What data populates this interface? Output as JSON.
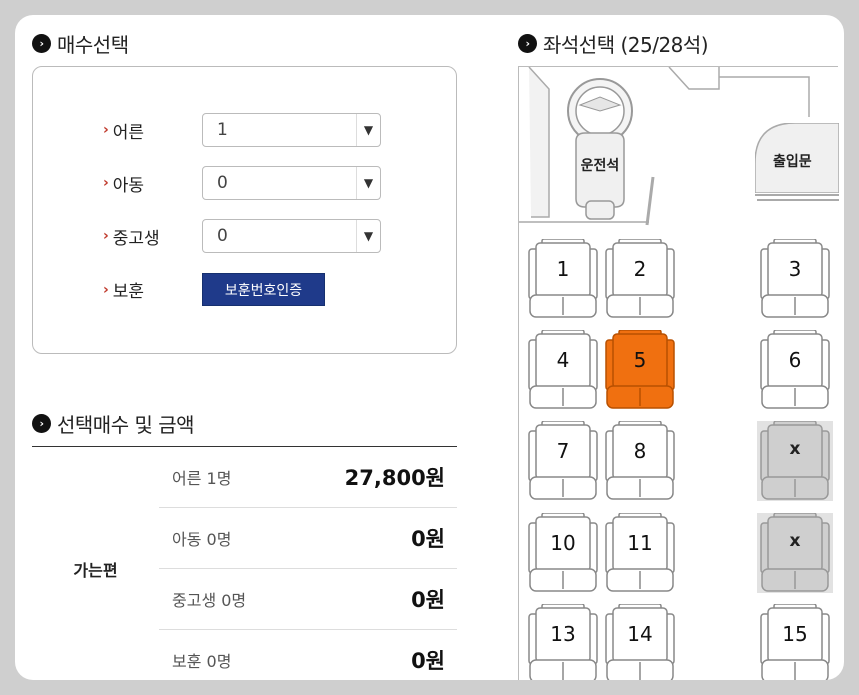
{
  "ticket": {
    "title": "매수선택",
    "rows": [
      {
        "label": "어른",
        "value": "1"
      },
      {
        "label": "아동",
        "value": "0"
      },
      {
        "label": "중고생",
        "value": "0"
      }
    ],
    "veteran_label": "보훈",
    "verify_button": "보훈번호인증"
  },
  "summary": {
    "title": "선택매수 및 금액",
    "direction": "가는편",
    "rows": [
      {
        "name": "어른 1명",
        "amount": "27,800원"
      },
      {
        "name": "아동 0명",
        "amount": "0원"
      },
      {
        "name": "중고생 0명",
        "amount": "0원"
      },
      {
        "name": "보훈 0명",
        "amount": "0원"
      }
    ]
  },
  "seats": {
    "title": "좌석선택 (25/28석)",
    "driver_label": "운전석",
    "door_label": "출입문",
    "list": [
      {
        "label": "1",
        "state": "available"
      },
      {
        "label": "2",
        "state": "available"
      },
      {
        "label": "3",
        "state": "available"
      },
      {
        "label": "4",
        "state": "available"
      },
      {
        "label": "5",
        "state": "selected"
      },
      {
        "label": "6",
        "state": "available"
      },
      {
        "label": "7",
        "state": "available"
      },
      {
        "label": "8",
        "state": "available"
      },
      {
        "label": "x",
        "state": "taken"
      },
      {
        "label": "10",
        "state": "available"
      },
      {
        "label": "11",
        "state": "available"
      },
      {
        "label": "x",
        "state": "taken"
      },
      {
        "label": "13",
        "state": "available"
      },
      {
        "label": "14",
        "state": "available"
      },
      {
        "label": "15",
        "state": "available"
      }
    ]
  },
  "colors": {
    "selected": "#f07010",
    "taken": "#cccccc",
    "button": "#1f3a8a"
  }
}
